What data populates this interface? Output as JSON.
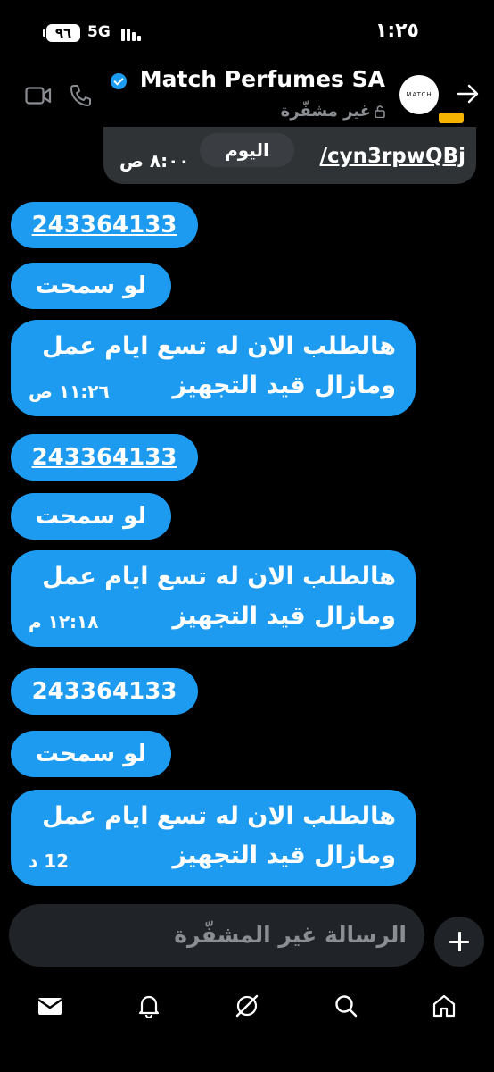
{
  "status_bar": {
    "battery": "٩٦",
    "network": "5G",
    "time": "١:٢٥"
  },
  "header": {
    "contact_name": "Match Perfumes SA",
    "verified_icon": "verified-badge-icon",
    "encryption_label": "غير مشفّرة",
    "avatar_text": "MATCH",
    "back_icon": "arrow-right-icon",
    "call_icon": "phone-icon",
    "video_icon": "video-icon"
  },
  "top_message": {
    "link_text": "/cyn3rpwQBj",
    "time": "٨:٠٠ ص"
  },
  "day_separator": "اليوم",
  "message_groups": [
    {
      "order_number": "243364133",
      "short_text": "لو سمحت",
      "long_line1": "هالطلب الان له تسع ايام عمل",
      "long_line2": "ومازال قيد التجهيز",
      "time": "١١:٢٦ ص"
    },
    {
      "order_number": "243364133",
      "short_text": "لو سمحت",
      "long_line1": "هالطلب الان له تسع ايام عمل",
      "long_line2": "ومازال قيد التجهيز",
      "time": "١٢:١٨ م"
    },
    {
      "order_number": "243364133",
      "short_text": "لو سمحت",
      "long_line1": "هالطلب الان له تسع ايام عمل",
      "long_line2": "ومازال قيد التجهيز",
      "time": "12 د"
    }
  ],
  "composer": {
    "placeholder": "الرسالة غير المشفّرة",
    "add_icon": "plus-icon"
  },
  "bottom_nav": [
    "mail-icon",
    "bell-icon",
    "grok-icon",
    "search-icon",
    "home-icon"
  ],
  "colors": {
    "bubble": "#1d9bf0",
    "background": "#000000",
    "received_bubble": "#2f3336",
    "composer": "#202327",
    "muted_text": "#8a8d91"
  }
}
